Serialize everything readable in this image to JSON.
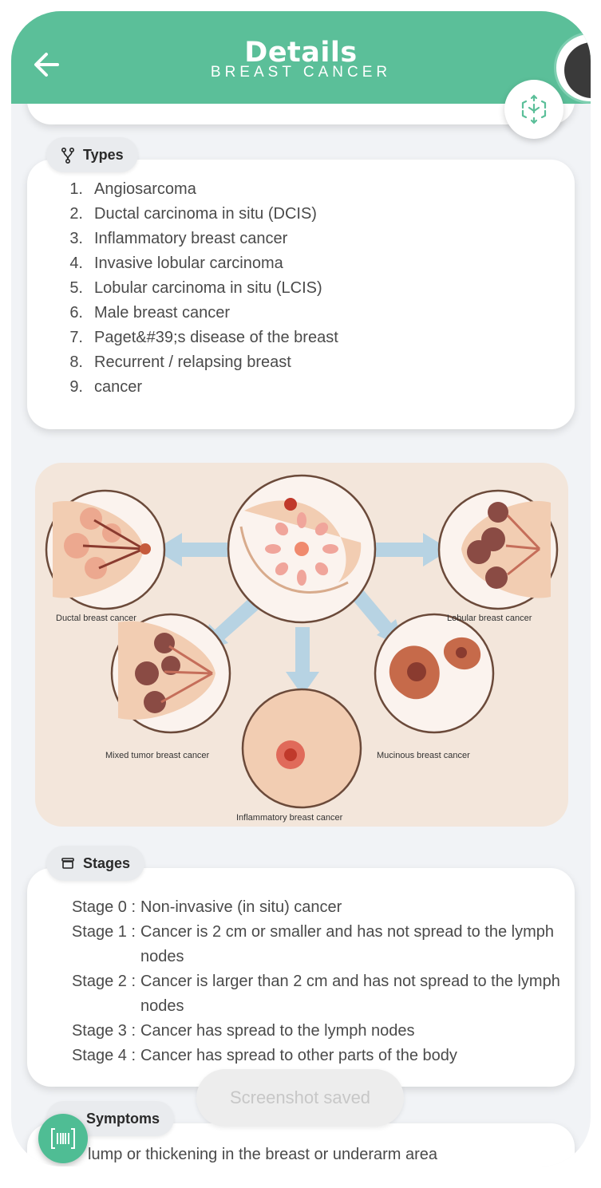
{
  "header": {
    "title": "Details",
    "subtitle": "BREAST CANCER",
    "color": "#5bbf99"
  },
  "types": {
    "label": "Types",
    "icon": "branch-icon",
    "items": [
      {
        "num": "1.",
        "text": "Angiosarcoma"
      },
      {
        "num": "2.",
        "text": "Ductal carcinoma in situ (DCIS)"
      },
      {
        "num": "3.",
        "text": "Inflammatory breast cancer"
      },
      {
        "num": "4.",
        "text": "Invasive lobular carcinoma"
      },
      {
        "num": "5.",
        "text": "Lobular carcinoma in situ (LCIS)"
      },
      {
        "num": "6.",
        "text": "Male breast cancer"
      },
      {
        "num": "7.",
        "text": "Paget&#39;s disease of the breast"
      },
      {
        "num": "8.",
        "text": "Recurrent / relapsing breast"
      },
      {
        "num": "9.",
        "text": "cancer"
      }
    ]
  },
  "illustration": {
    "labels": {
      "ductal": "Ductal breast cancer",
      "lobular": "Lobular breast cancer",
      "mixed": "Mixed tumor breast cancer",
      "mucinous": "Mucinous breast cancer",
      "inflammatory": "Inflammatory breast cancer"
    }
  },
  "stages": {
    "label": "Stages",
    "icon": "archive-icon",
    "items": [
      {
        "label": "Stage 0 :",
        "text": "Non-invasive (in situ) cancer"
      },
      {
        "label": " Stage 1 :",
        "text": "Cancer is 2 cm or smaller and has not spread to the lymph nodes"
      },
      {
        "label": "Stage 2 :",
        "text": "Cancer is larger than 2 cm and has not spread to the lymph nodes"
      },
      {
        "label": "Stage 3 :",
        "text": "Cancer has spread to the lymph nodes"
      },
      {
        "label": "Stage 4 :",
        "text": "Cancer has spread to other parts of the body"
      }
    ]
  },
  "symptoms": {
    "label": "Symptoms",
    "first_item": "lump or thickening in the breast or underarm area"
  },
  "toast": "Screenshot saved"
}
